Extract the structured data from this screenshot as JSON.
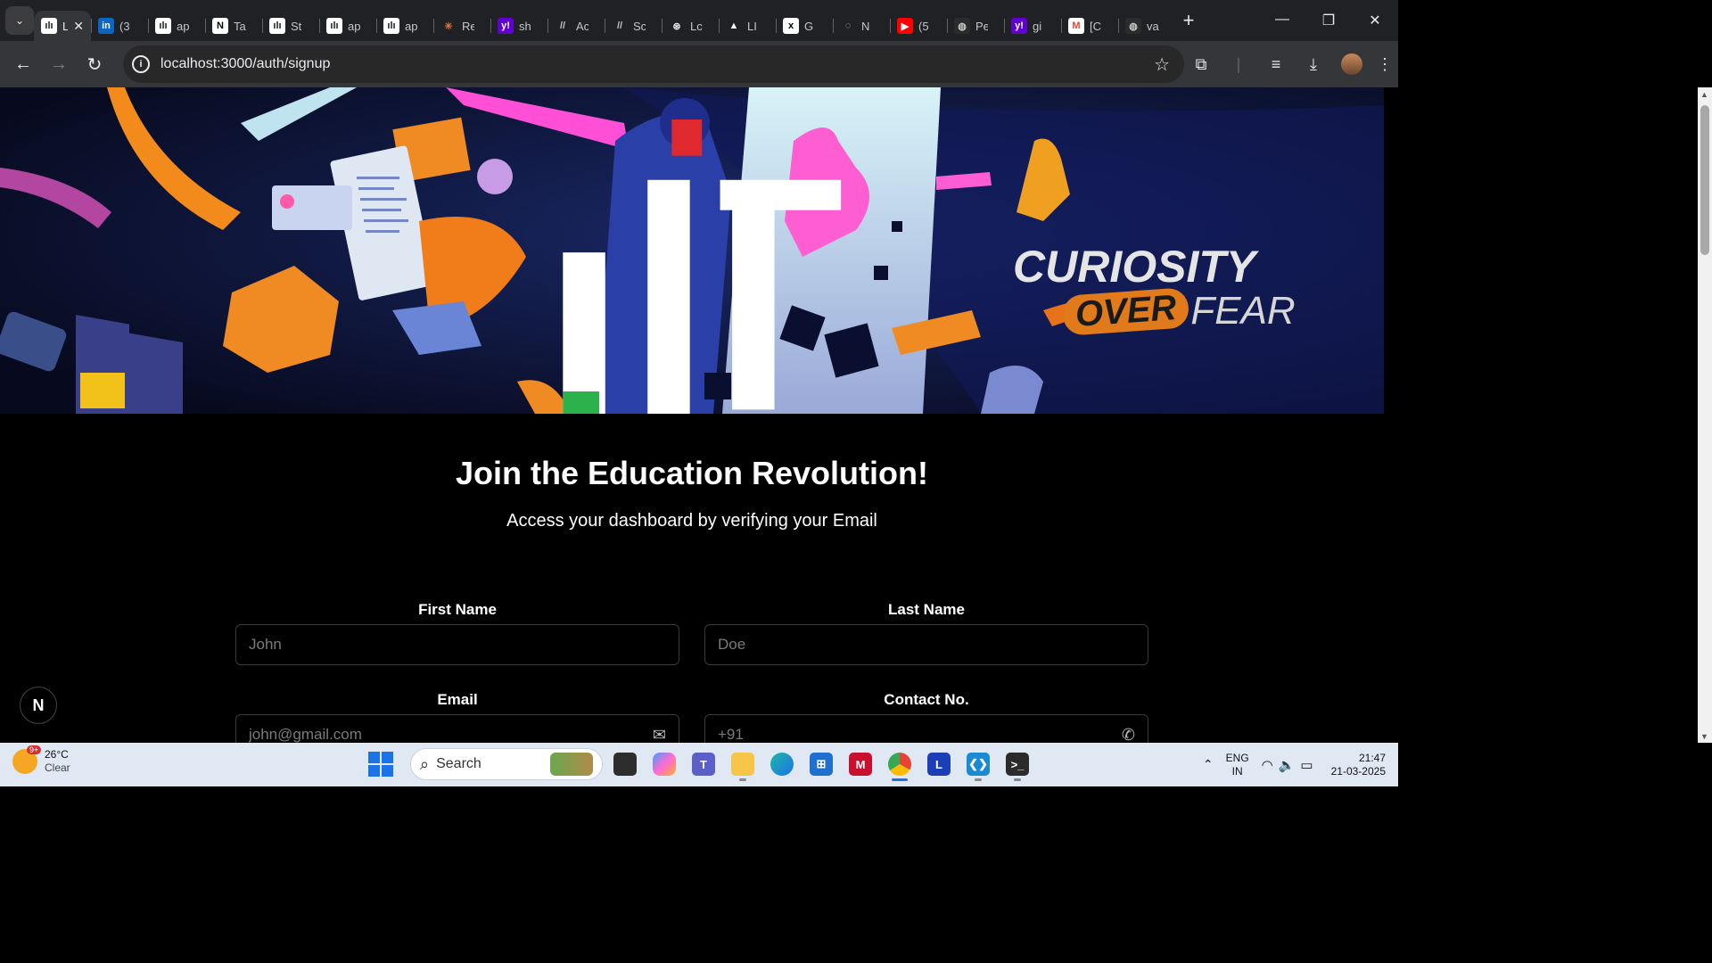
{
  "browser": {
    "tabs": [
      {
        "title": "LI",
        "icon": "app-logo-icon",
        "active": true
      },
      {
        "title": "(3",
        "icon": "linkedin-icon"
      },
      {
        "title": "ap",
        "icon": "app-logo-icon"
      },
      {
        "title": "Ta",
        "icon": "notion-icon"
      },
      {
        "title": "St",
        "icon": "app-logo-icon"
      },
      {
        "title": "ap",
        "icon": "app-logo-icon"
      },
      {
        "title": "ap",
        "icon": "app-logo-icon"
      },
      {
        "title": "Re",
        "icon": "claude-icon"
      },
      {
        "title": "sh",
        "icon": "yahoo-icon"
      },
      {
        "title": "Ac",
        "icon": "slash-icon"
      },
      {
        "title": "Sc",
        "icon": "slash-icon"
      },
      {
        "title": "Lc",
        "icon": "openai-icon"
      },
      {
        "title": "LI",
        "icon": "vercel-icon"
      },
      {
        "title": "G",
        "icon": "x-icon"
      },
      {
        "title": "N",
        "icon": "spinner-icon"
      },
      {
        "title": "(5",
        "icon": "youtube-icon"
      },
      {
        "title": "Pe",
        "icon": "github-icon"
      },
      {
        "title": "gi",
        "icon": "yahoo-icon"
      },
      {
        "title": "[C",
        "icon": "gmail-icon"
      },
      {
        "title": "va",
        "icon": "github-icon"
      }
    ],
    "url": "localhost:3000/auth/signup"
  },
  "banner": {
    "tagline_line1": "CURIOSITY",
    "tagline_over": "OVER",
    "tagline_fear": "FEAR"
  },
  "page": {
    "title": "Join the Education Revolution!",
    "subtitle": "Access your dashboard by verifying your Email",
    "fields": {
      "first_name": {
        "label": "First Name",
        "placeholder": "John"
      },
      "last_name": {
        "label": "Last Name",
        "placeholder": "Doe"
      },
      "email": {
        "label": "Email",
        "placeholder": "john@gmail.com"
      },
      "contact": {
        "label": "Contact No.",
        "placeholder": "+91"
      }
    },
    "dev_badge": "N"
  },
  "taskbar": {
    "weather_badge": "9+",
    "temperature": "26°C",
    "condition": "Clear",
    "search_label": "Search",
    "lang_line1": "ENG",
    "lang_line2": "IN",
    "time": "21:47",
    "date": "21-03-2025"
  },
  "colors": {
    "accent_orange": "#e07a1a",
    "banner_bg": "#0b1030",
    "page_bg": "#000000"
  }
}
